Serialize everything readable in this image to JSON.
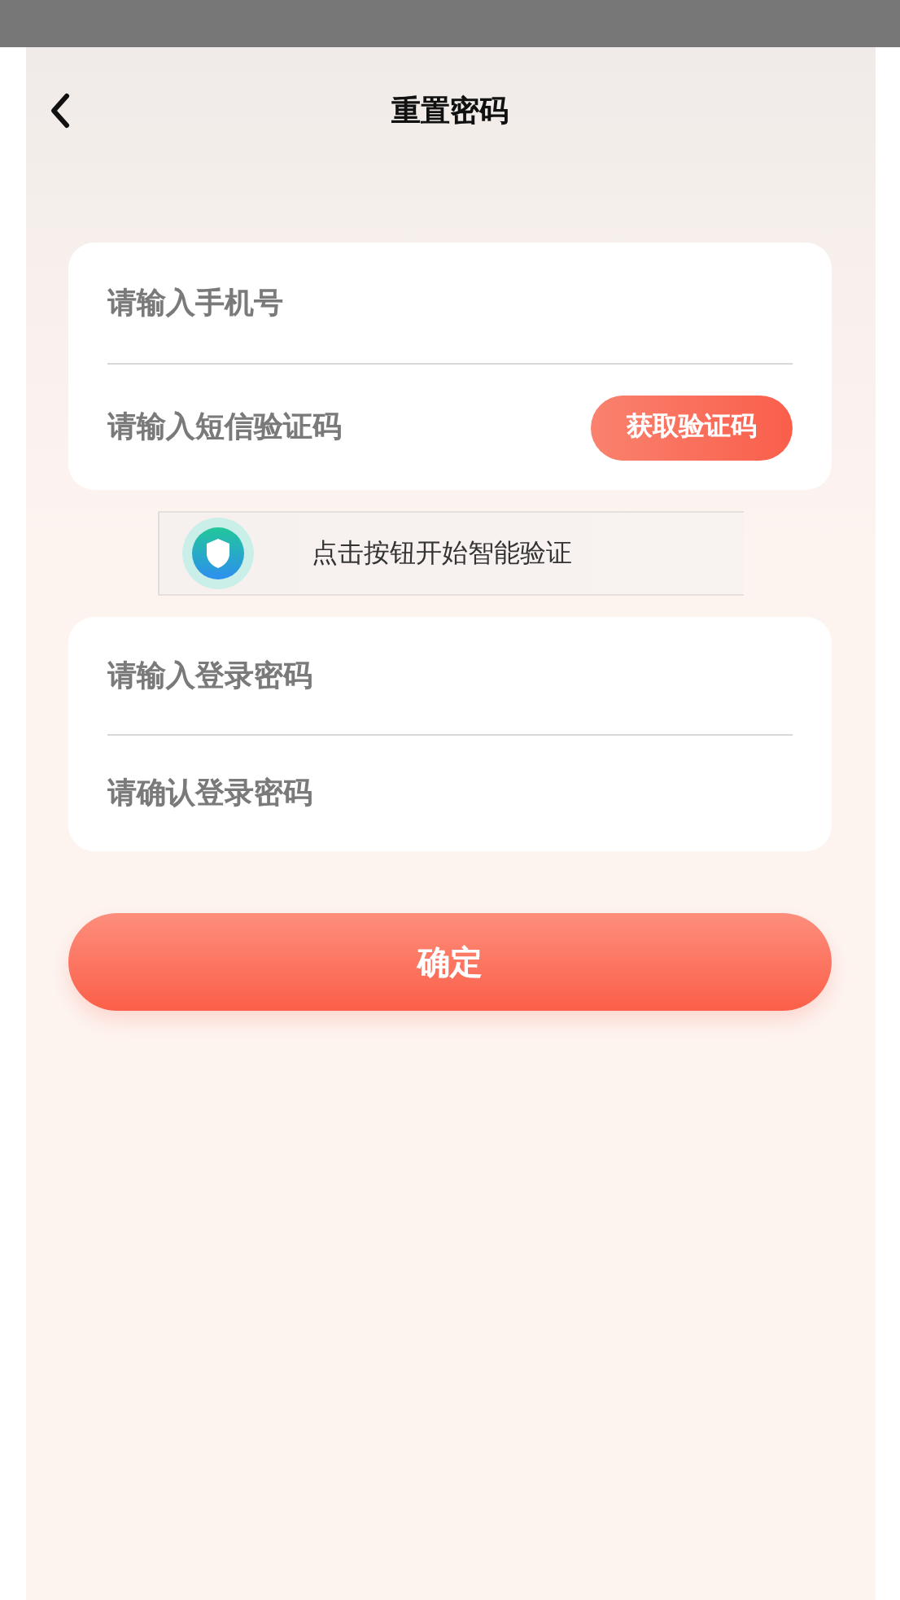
{
  "header": {
    "title": "重置密码"
  },
  "account_card": {
    "fields": [
      {
        "placeholder": "请输入手机号"
      },
      {
        "placeholder": "请输入短信验证码"
      }
    ],
    "code_button": "获取验证码"
  },
  "captcha": {
    "label": "点击按钮开始智能验证"
  },
  "password_card": {
    "fields": [
      {
        "placeholder": "请输入登录密码"
      },
      {
        "placeholder": "请确认登录密码"
      }
    ]
  },
  "confirm_button": "确定"
}
